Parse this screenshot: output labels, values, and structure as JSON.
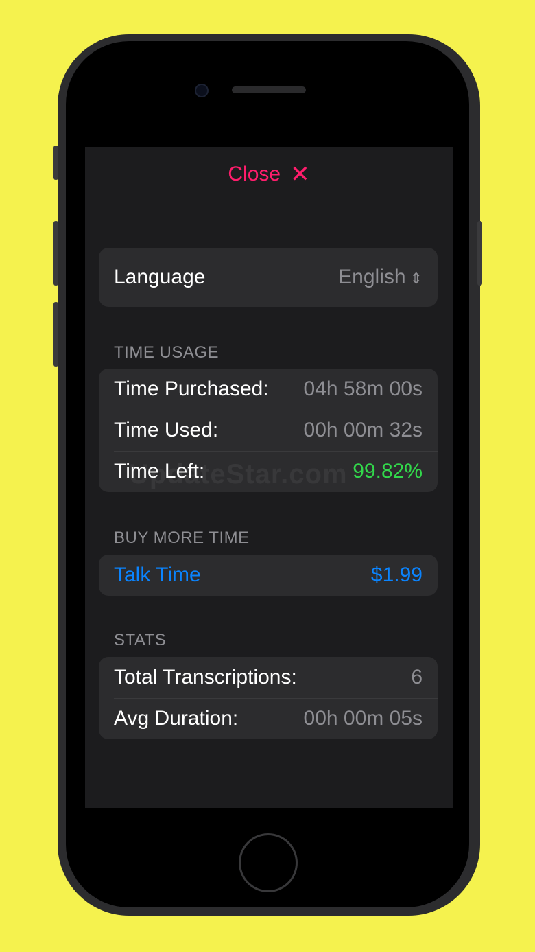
{
  "header": {
    "close_label": "Close",
    "close_icon": "✕"
  },
  "language": {
    "label": "Language",
    "value": "English",
    "chevron": "⌃⌄"
  },
  "time_usage": {
    "header": "TIME USAGE",
    "rows": [
      {
        "label": "Time Purchased:",
        "value": "04h 58m 00s"
      },
      {
        "label": "Time Used:",
        "value": "00h 00m 32s"
      },
      {
        "label": "Time Left:",
        "value": "99.82%"
      }
    ]
  },
  "buy_more": {
    "header": "BUY MORE TIME",
    "item": {
      "label": "Talk Time",
      "price": "$1.99"
    }
  },
  "stats": {
    "header": "STATS",
    "rows": [
      {
        "label": "Total Transcriptions:",
        "value": "6"
      },
      {
        "label": "Avg Duration:",
        "value": "00h 00m 05s"
      }
    ]
  },
  "watermark": "UpdateStar.com",
  "colors": {
    "accent_close": "#ff1d6c",
    "positive": "#32d74b",
    "link": "#0a84ff",
    "background": "#f5f24e"
  }
}
